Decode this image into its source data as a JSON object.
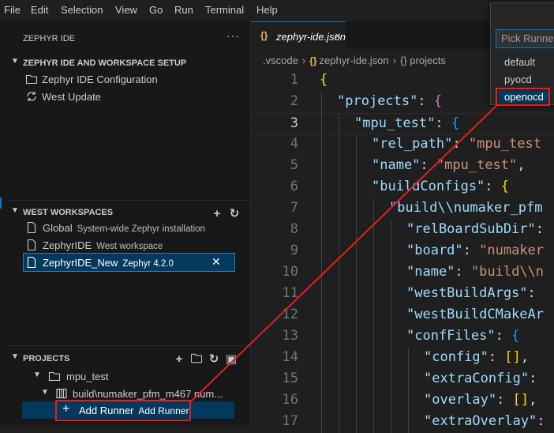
{
  "menubar": {
    "items": [
      "File",
      "Edit",
      "Selection",
      "View",
      "Go",
      "Run",
      "Terminal",
      "Help"
    ]
  },
  "sidebar": {
    "title": "ZEPHYR IDE",
    "more": "···",
    "setup": {
      "header": "ZEPHYR IDE AND WORKSPACE SETUP",
      "items": [
        "Zephyr IDE Configuration",
        "West Update"
      ]
    },
    "west": {
      "header": "WEST WORKSPACES",
      "items": [
        {
          "name": "Global",
          "desc": "System-wide Zephyr installation"
        },
        {
          "name": "ZephyrIDE",
          "desc": "West workspace"
        },
        {
          "name": "ZephyrIDE_New",
          "desc": "Zephyr 4.2.0"
        }
      ]
    },
    "projects": {
      "header": "PROJECTS",
      "project": "mpu_test",
      "build": "build\\numaker_pfm_m467 num...",
      "add_runner": "Add Runner",
      "add_runner_desc": "Add Runner"
    }
  },
  "editor": {
    "tab": {
      "icon": "{}",
      "name": "zephyr-ide.json",
      "close": "×"
    },
    "breadcrumb": [
      ".vscode",
      "zephyr-ide.json",
      "projects"
    ],
    "current_line": 3
  },
  "code_lines": [
    [
      [
        "b1",
        "{"
      ]
    ],
    [
      [
        "k",
        "\"projects\""
      ],
      [
        "p",
        ": "
      ],
      [
        "b2",
        "{"
      ]
    ],
    [
      [
        "k",
        "\"mpu_test\""
      ],
      [
        "p",
        ": "
      ],
      [
        "b3",
        "{"
      ]
    ],
    [
      [
        "k",
        "\"rel_path\""
      ],
      [
        "p",
        ": "
      ],
      [
        "s",
        "\"mpu_test"
      ]
    ],
    [
      [
        "k",
        "\"name\""
      ],
      [
        "p",
        ": "
      ],
      [
        "s",
        "\"mpu_test\""
      ],
      [
        "p",
        ","
      ]
    ],
    [
      [
        "k",
        "\"buildConfigs\""
      ],
      [
        "p",
        ": "
      ],
      [
        "b1",
        "{"
      ]
    ],
    [
      [
        "k",
        "\"build\\\\numaker_pfm"
      ]
    ],
    [
      [
        "k",
        "\"relBoardSubDir\""
      ],
      [
        "p",
        ":"
      ]
    ],
    [
      [
        "k",
        "\"board\""
      ],
      [
        "p",
        ": "
      ],
      [
        "s",
        "\"numaker"
      ]
    ],
    [
      [
        "k",
        "\"name\""
      ],
      [
        "p",
        ": "
      ],
      [
        "s",
        "\"build\\\\n"
      ]
    ],
    [
      [
        "k",
        "\"westBuildArgs\""
      ],
      [
        "p",
        ":"
      ]
    ],
    [
      [
        "k",
        "\"westBuildCMakeAr"
      ]
    ],
    [
      [
        "k",
        "\"confFiles\""
      ],
      [
        "p",
        ": "
      ],
      [
        "b3",
        "{"
      ]
    ],
    [
      [
        "k",
        "\"config\""
      ],
      [
        "p",
        ": "
      ],
      [
        "b1",
        "[]"
      ],
      [
        "p",
        ","
      ]
    ],
    [
      [
        "k",
        "\"extraConfig\""
      ],
      [
        "p",
        ":"
      ]
    ],
    [
      [
        "k",
        "\"overlay\""
      ],
      [
        "p",
        ": "
      ],
      [
        "b1",
        "[]"
      ],
      [
        "p",
        ","
      ]
    ],
    [
      [
        "k",
        "\"extraOverlay\""
      ],
      [
        "p",
        ":"
      ]
    ]
  ],
  "runner_picker": {
    "placeholder": "Pick Runner",
    "options": [
      "default",
      "pyocd",
      "openocd"
    ],
    "highlighted": "openocd"
  },
  "colors": {
    "accent": "#0078d4",
    "annotation": "#e02020",
    "json_icon": "#e8c05a"
  }
}
